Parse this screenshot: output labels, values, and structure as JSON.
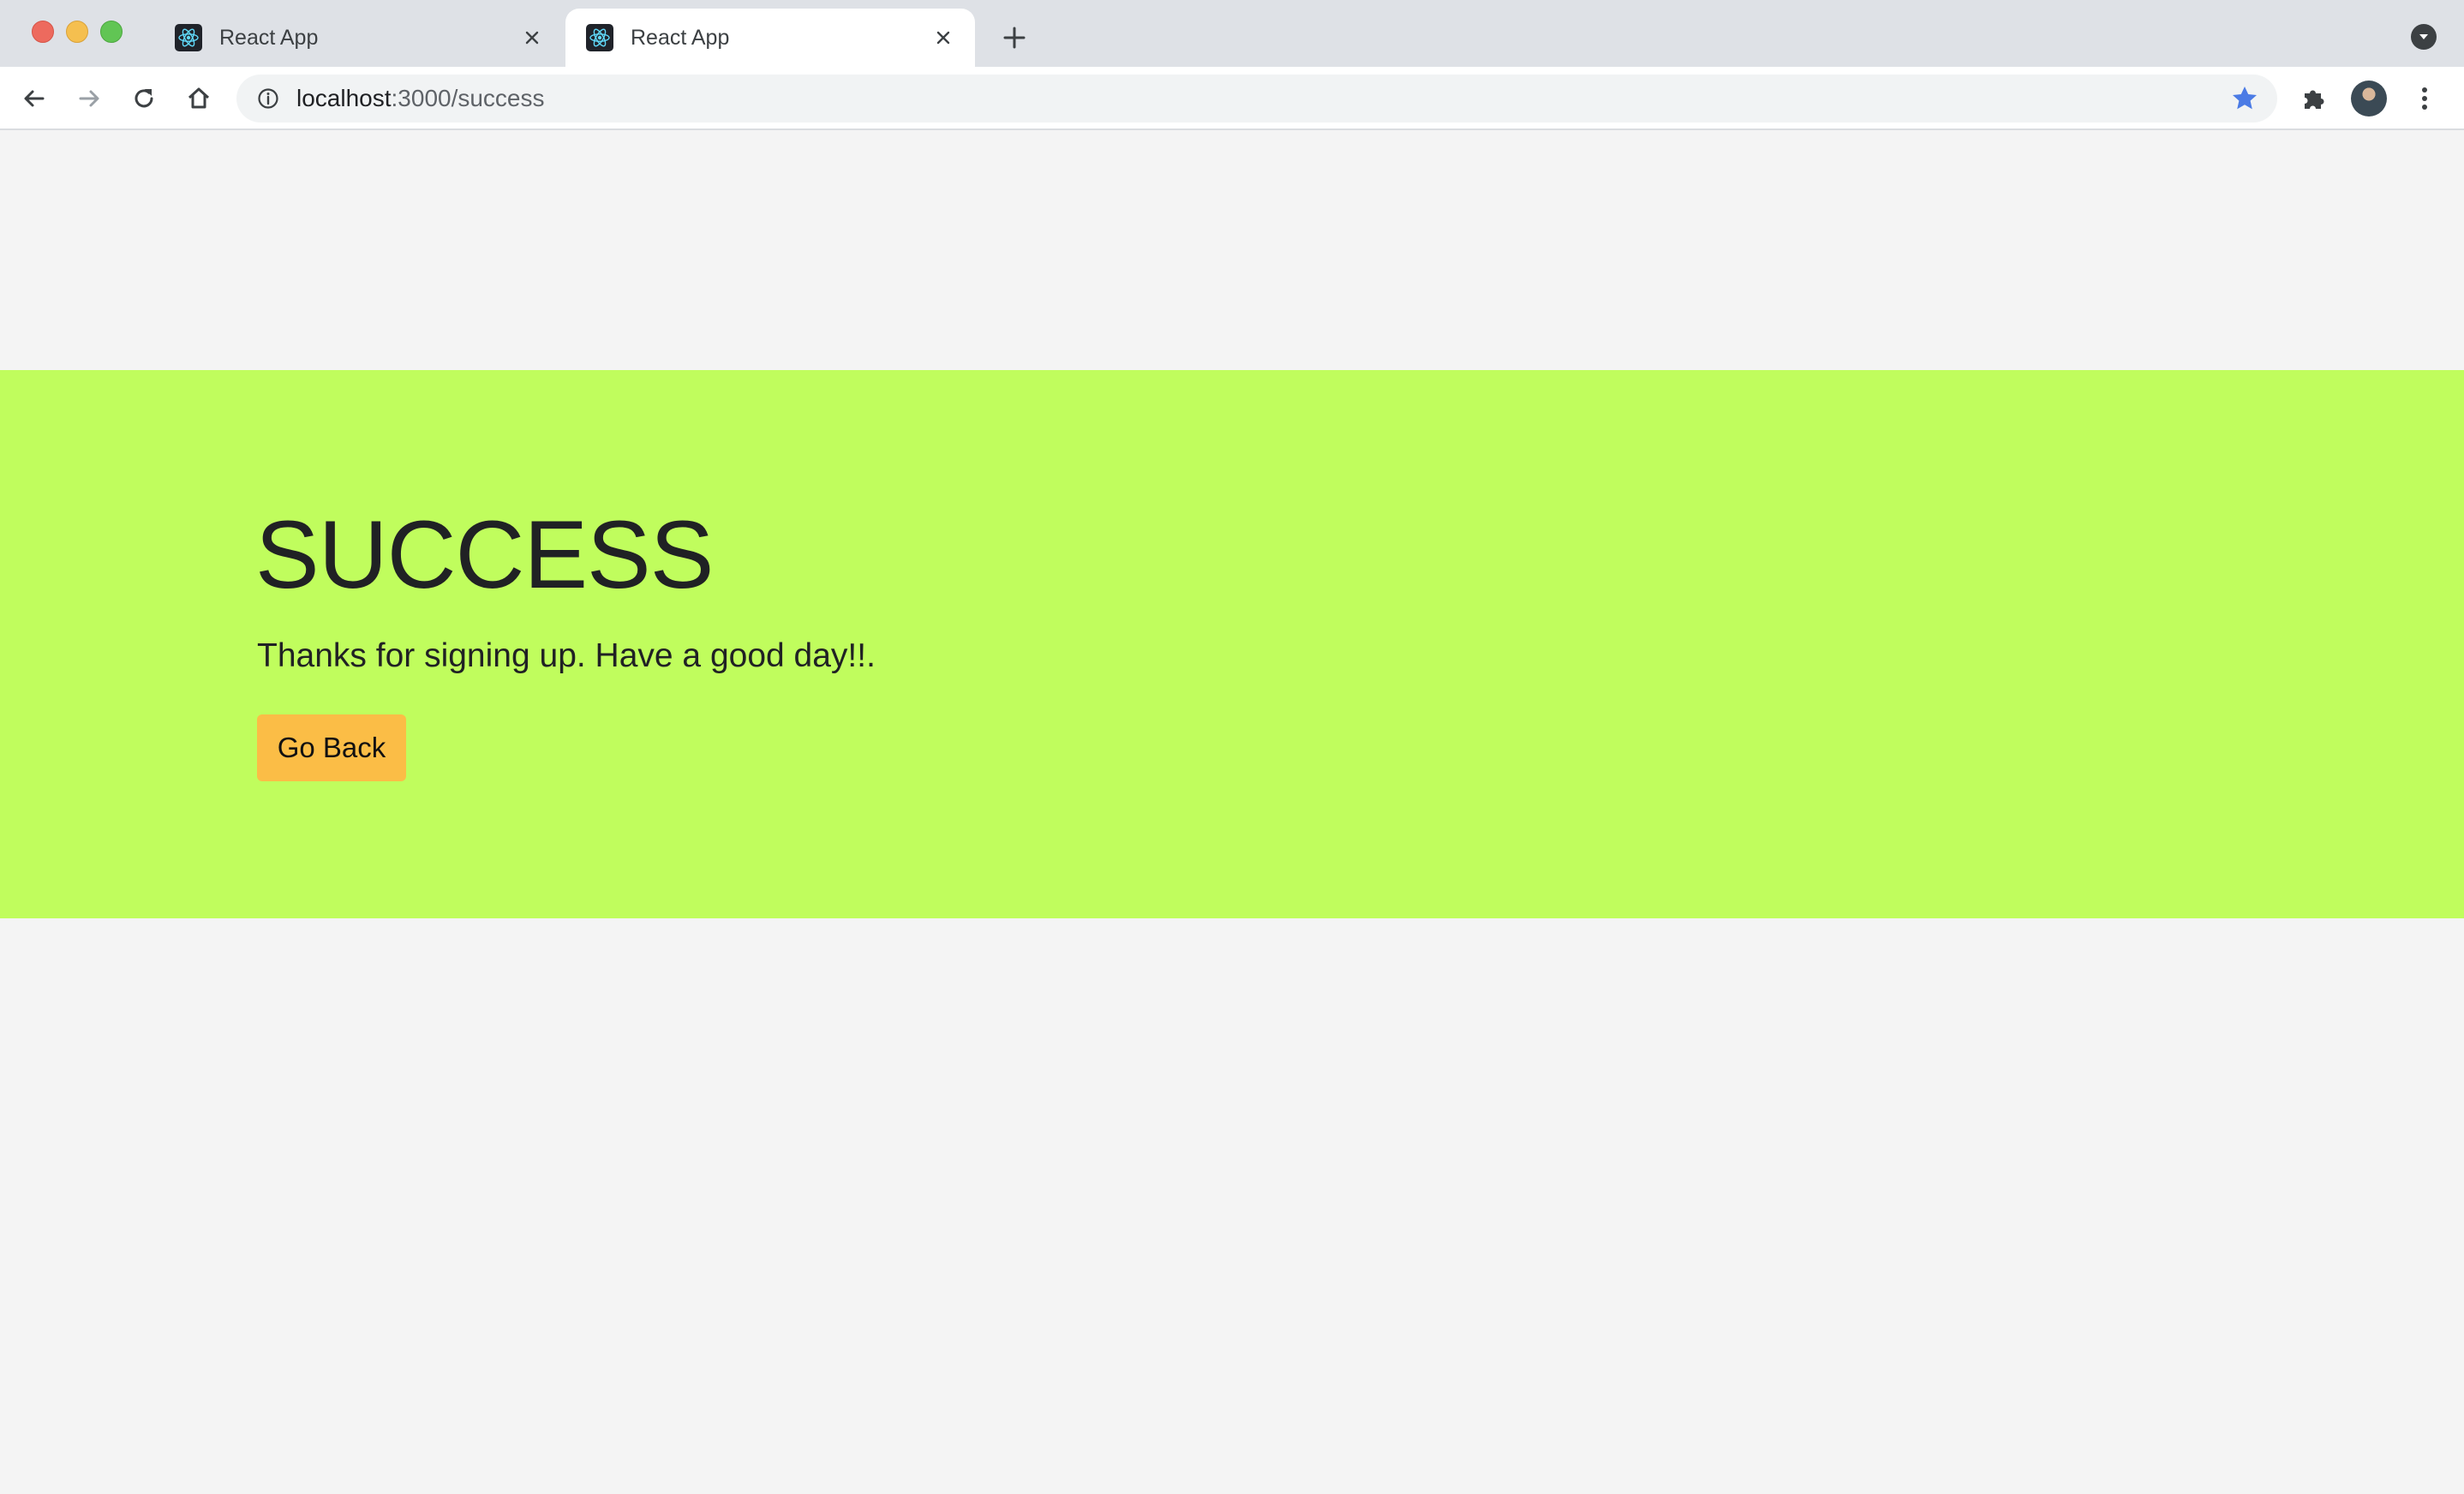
{
  "browser": {
    "tabs": [
      {
        "label": "React App",
        "active": false
      },
      {
        "label": "React App",
        "active": true
      }
    ],
    "url_host": "localhost",
    "url_path": ":3000/success"
  },
  "content": {
    "heading": "SUCCESS",
    "message": "Thanks for signing up. Have a good day!!.",
    "button_label": "Go Back"
  },
  "colors": {
    "banner": "#c0fd5d",
    "button": "#fbbd46",
    "page_background": "#f4f4f4"
  },
  "icons": {
    "tab_favicon": "react-logo-icon",
    "bookmark": "star-icon",
    "extensions": "puzzle-icon"
  }
}
